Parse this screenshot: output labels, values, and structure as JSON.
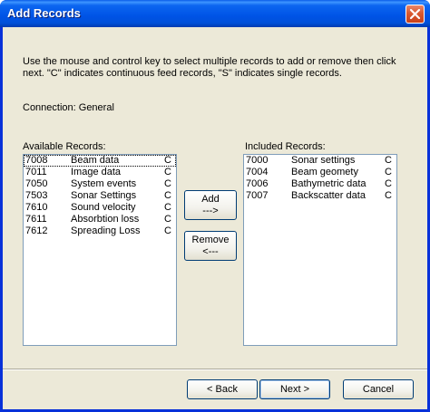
{
  "window": {
    "title": "Add Records"
  },
  "instructions": "Use the mouse and control key to select multiple records to add or remove  then click next.  \"C\" indicates continuous feed records, \"S\" indicates single records.",
  "connection": "Connection: General",
  "available": {
    "label": "Available Records:",
    "rows": [
      {
        "id": "7008",
        "name": "Beam data",
        "type": "C"
      },
      {
        "id": "7011",
        "name": "Image data",
        "type": "C"
      },
      {
        "id": "7050",
        "name": "System events",
        "type": "C"
      },
      {
        "id": "7503",
        "name": "Sonar Settings",
        "type": "C"
      },
      {
        "id": "7610",
        "name": "Sound velocity",
        "type": "C"
      },
      {
        "id": "7611",
        "name": "Absorbtion loss",
        "type": "C"
      },
      {
        "id": "7612",
        "name": "Spreading Loss",
        "type": "C"
      }
    ]
  },
  "included": {
    "label": "Included Records:",
    "rows": [
      {
        "id": "7000",
        "name": "Sonar settings",
        "type": "C"
      },
      {
        "id": "7004",
        "name": "Beam geomety",
        "type": "C"
      },
      {
        "id": "7006",
        "name": "Bathymetric data",
        "type": "C"
      },
      {
        "id": "7007",
        "name": "Backscatter data",
        "type": "C"
      }
    ]
  },
  "buttons": {
    "add_line1": "Add",
    "add_line2": "--->",
    "remove_line1": "Remove",
    "remove_line2": "<---",
    "back": "< Back",
    "next": "Next >",
    "cancel": "Cancel"
  },
  "colors": {
    "title_bar": "#0053e6",
    "close_button": "#d9592f",
    "dialog_face": "#ece9d8",
    "list_border": "#7f9db9"
  }
}
